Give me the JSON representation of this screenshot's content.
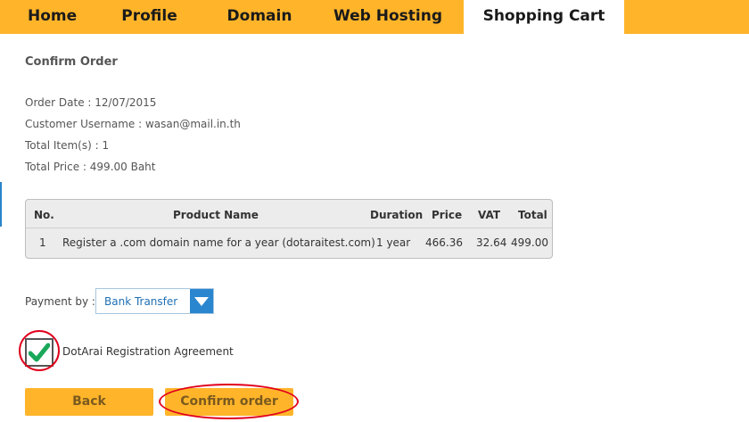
{
  "nav": {
    "home": "Home",
    "profile": "Profile",
    "domain": "Domain",
    "web_hosting": "Web Hosting",
    "shopping_cart": "Shopping Cart"
  },
  "page": {
    "title": "Confirm Order",
    "order_date": "Order Date : 12/07/2015",
    "customer_username": "Customer Username : wasan@mail.in.th",
    "total_items": "Total Item(s) : 1",
    "total_price": "Total Price : 499.00 Baht"
  },
  "order_table": {
    "headers": [
      "No.",
      "Product Name",
      "Duration",
      "Price",
      "VAT",
      "Total"
    ],
    "rows": [
      [
        "1",
        "Register a .com domain name for a year (dotaraitest.com)",
        "1 year",
        "466.36",
        "32.64",
        "499.00"
      ]
    ]
  },
  "payment": {
    "label": "Payment by :",
    "selected": "Bank Transfer"
  },
  "agreement": {
    "label": "DotArai Registration Agreement",
    "checked": true
  },
  "buttons": {
    "back": "Back",
    "confirm": "Confirm order"
  },
  "colors": {
    "nav_bg": "#ffb42a",
    "accent_blue": "#2a86cf",
    "highlight_red": "#e0001b",
    "check_green": "#19a85a"
  }
}
